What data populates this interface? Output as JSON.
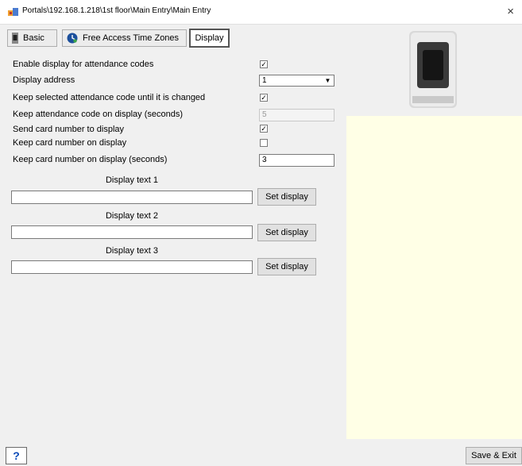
{
  "window": {
    "title": "Portals\\192.168.1.218\\1st floor\\Main Entry\\Main Entry",
    "close_glyph": "×"
  },
  "tabs": [
    {
      "label": "Basic",
      "icon": "device-icon"
    },
    {
      "label": "Free Access Time Zones",
      "icon": "clock-globe-icon"
    },
    {
      "label": "Display",
      "active": true
    }
  ],
  "settings": {
    "enable_display_label": "Enable display for attendance codes",
    "enable_display_checked": true,
    "display_address_label": "Display address",
    "display_address_value": "1",
    "keep_selected_label": "Keep selected attendance code until it is changed",
    "keep_selected_checked": true,
    "keep_code_seconds_label": "Keep attendance code on display (seconds)",
    "keep_code_seconds_value": "5",
    "send_card_label": "Send card number to display",
    "send_card_checked": true,
    "keep_card_label": "Keep card number on display",
    "keep_card_checked": false,
    "keep_card_seconds_label": "Keep card number on display (seconds)",
    "keep_card_seconds_value": "3"
  },
  "display_texts": [
    {
      "label": "Display text 1",
      "value": "",
      "button": "Set display"
    },
    {
      "label": "Display text 2",
      "value": "",
      "button": "Set display"
    },
    {
      "label": "Display text 3",
      "value": "",
      "button": "Set display"
    }
  ],
  "footer": {
    "help_label": "?",
    "save_exit_label": "Save & Exit"
  },
  "colors": {
    "preview_background": "#ffffe6",
    "help_accent": "#0a4ab8"
  }
}
